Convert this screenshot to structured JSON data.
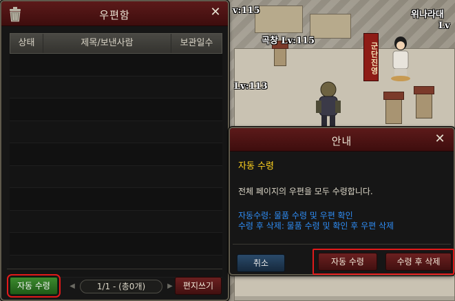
{
  "mailbox": {
    "title": "우편함",
    "columns": [
      "상태",
      "제목/보낸사람",
      "보관일수"
    ],
    "rows": 10,
    "auto_receive_label": "자동 수령",
    "pager_text": "1/1 - (총0개)",
    "write_label": "편지쓰기"
  },
  "notice": {
    "title": "안내",
    "heading": "자동 수령",
    "message": "전체 페이지의 우편을 모두 수령합니다.",
    "desc_line1": "자동수령: 물품 수령 및 우편 확인",
    "desc_line2": "수령 후 삭제: 물품 수령 및 확인 후 우편 삭제",
    "cancel_label": "취소",
    "receive_label": "자동 수령",
    "receive_delete_label": "수령 후 삭제"
  },
  "world": {
    "labels": [
      {
        "name": "lv-label-1",
        "text": "v:115"
      },
      {
        "name": "lv-label-2",
        "text": "곡창 Lv:115"
      },
      {
        "name": "lv-label-3",
        "text": "Lv:113"
      },
      {
        "name": "lv-label-4",
        "text": "위나라대"
      },
      {
        "name": "lv-label-5",
        "text": "Lv"
      }
    ],
    "banner_text": "군단진영"
  },
  "colors": {
    "title_bar": "#4a1212",
    "highlight": "#e21a1a",
    "notice_heading": "#ffd21f",
    "notice_desc": "#2f8cf3",
    "auto_button": "#2d7422"
  }
}
